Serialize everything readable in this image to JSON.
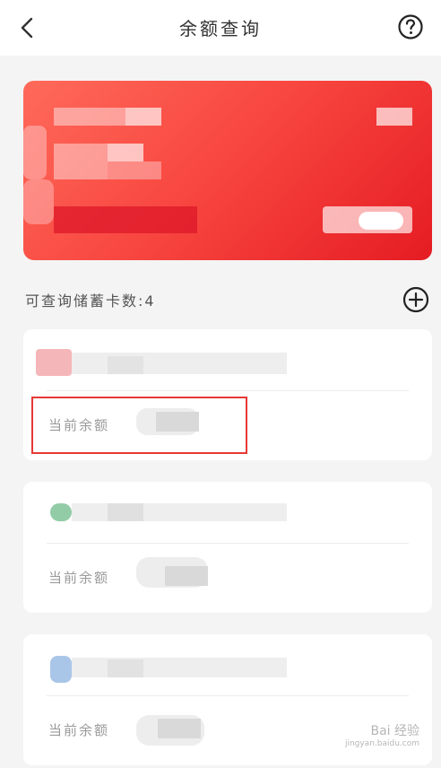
{
  "header": {
    "title": "余额查询",
    "back_icon": "chevron-left-icon",
    "help_icon": "question-circle-icon"
  },
  "section": {
    "label": "可查询储蓄卡数:4",
    "add_icon": "plus-circle-icon"
  },
  "accounts": [
    {
      "balance_label": "当前余额",
      "bank_color": "#f3a4a8"
    },
    {
      "balance_label": "当前余额",
      "bank_color": "#39a35c"
    },
    {
      "balance_label": "当前余额",
      "bank_color": "#a9c6e8"
    }
  ],
  "colors": {
    "accent_red": "#e53935",
    "card_gradient_start": "#ff6a5a",
    "card_gradient_end": "#e51c23"
  },
  "watermark": {
    "text": "Bai 经验",
    "sub": "jingyan.baidu.com"
  }
}
